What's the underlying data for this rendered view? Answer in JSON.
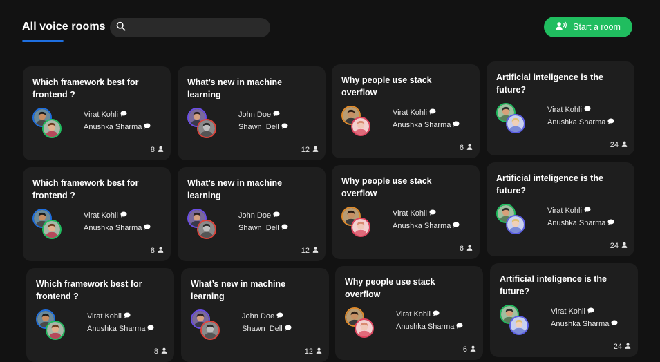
{
  "header": {
    "title": "All voice rooms",
    "search_placeholder": "",
    "start_button_label": "Start a room",
    "accent_color": "#1e6fe0",
    "button_color": "#20bd5f"
  },
  "rooms": [
    {
      "title": "Which framework best for frontend ?",
      "speakers": [
        "Virat Kohli",
        "Anushka Sharma"
      ],
      "count": "8"
    },
    {
      "title": "What’s new in machine learning",
      "speakers": [
        "John Doe",
        "Shawn  Dell"
      ],
      "count": "12"
    },
    {
      "title": "Why people use stack overflow",
      "speakers": [
        "Virat Kohli",
        "Anushka Sharma"
      ],
      "count": "6"
    },
    {
      "title": "Artificial inteligence is the future?",
      "speakers": [
        "Virat Kohli",
        "Anushka Sharma"
      ],
      "count": "24"
    },
    {
      "title": "Which framework best for frontend ?",
      "speakers": [
        "Virat Kohli",
        "Anushka Sharma"
      ],
      "count": "8"
    },
    {
      "title": "What’s new in machine learning",
      "speakers": [
        "John Doe",
        "Shawn  Dell"
      ],
      "count": "12"
    },
    {
      "title": "Why people use stack overflow",
      "speakers": [
        "Virat Kohli",
        "Anushka Sharma"
      ],
      "count": "6"
    },
    {
      "title": "Artificial inteligence is the future?",
      "speakers": [
        "Virat Kohli",
        "Anushka Sharma"
      ],
      "count": "24"
    },
    {
      "title": "Which framework best for frontend ?",
      "speakers": [
        "Virat Kohli",
        "Anushka Sharma"
      ],
      "count": "8"
    },
    {
      "title": "What’s new in machine learning",
      "speakers": [
        "John Doe",
        "Shawn  Dell"
      ],
      "count": "12"
    },
    {
      "title": "Why people use stack overflow",
      "speakers": [
        "Virat Kohli",
        "Anushka Sharma"
      ],
      "count": "6"
    },
    {
      "title": "Artificial inteligence is the future?",
      "speakers": [
        "Virat Kohli",
        "Anushka Sharma"
      ],
      "count": "24"
    }
  ],
  "avatar_ring_colors": [
    [
      "#1e6fe0",
      "#20bd5f"
    ],
    [
      "#6b4de6",
      "#e0433a"
    ],
    [
      "#e08a2a",
      "#e0435f"
    ],
    [
      "#20bd5f",
      "#5b5fe6"
    ]
  ],
  "icons": {
    "search": "search-icon",
    "start": "speaker-icon",
    "chat": "chat-bubble-icon",
    "user": "user-icon"
  }
}
